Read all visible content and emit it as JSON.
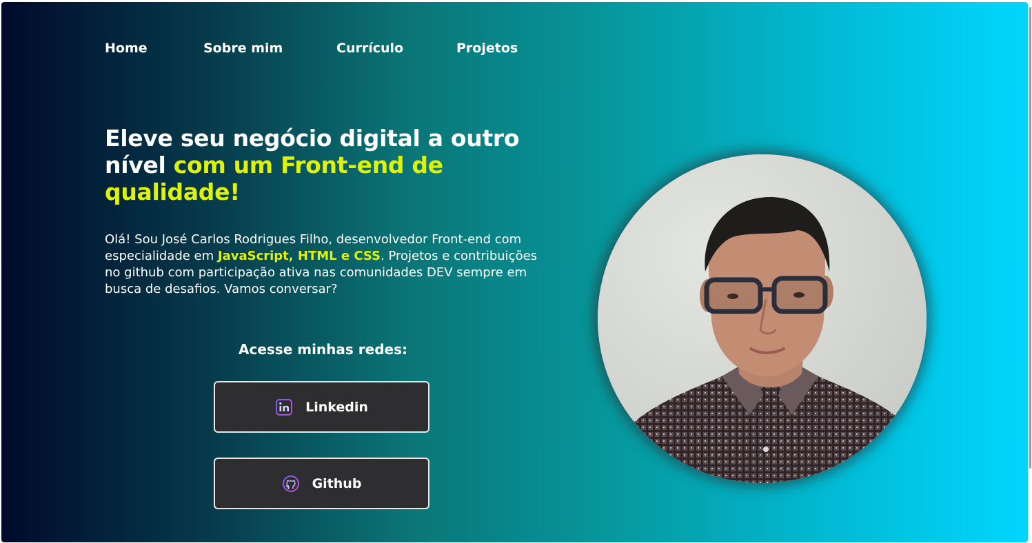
{
  "nav": {
    "items": [
      {
        "label": "Home"
      },
      {
        "label": "Sobre mim"
      },
      {
        "label": "Currículo"
      },
      {
        "label": "Projetos"
      }
    ]
  },
  "hero": {
    "headline_part1": "Eleve seu negócio digital a outro nível ",
    "headline_part2": "com um Front-end de qualidade!",
    "intro_part1": "Olá! Sou José Carlos Rodrigues Filho, desenvolvedor Front-end com especialidade em ",
    "intro_highlight": "JavaScript, HTML e CSS",
    "intro_part2": ". Projetos e contribuições no github com participação ativa nas comunidades DEV sempre em busca de desafios. Vamos conversar?"
  },
  "networks": {
    "title": "Acesse minhas redes:",
    "linkedin_label": "Linkedin",
    "github_label": "Github",
    "linkedin_icon": "linkedin-icon",
    "github_icon": "github-icon"
  },
  "colors": {
    "highlight": "#dff20a",
    "gradient_start": "#000a2a",
    "gradient_end": "#00d6fe",
    "button_bg": "#2e2e30"
  }
}
